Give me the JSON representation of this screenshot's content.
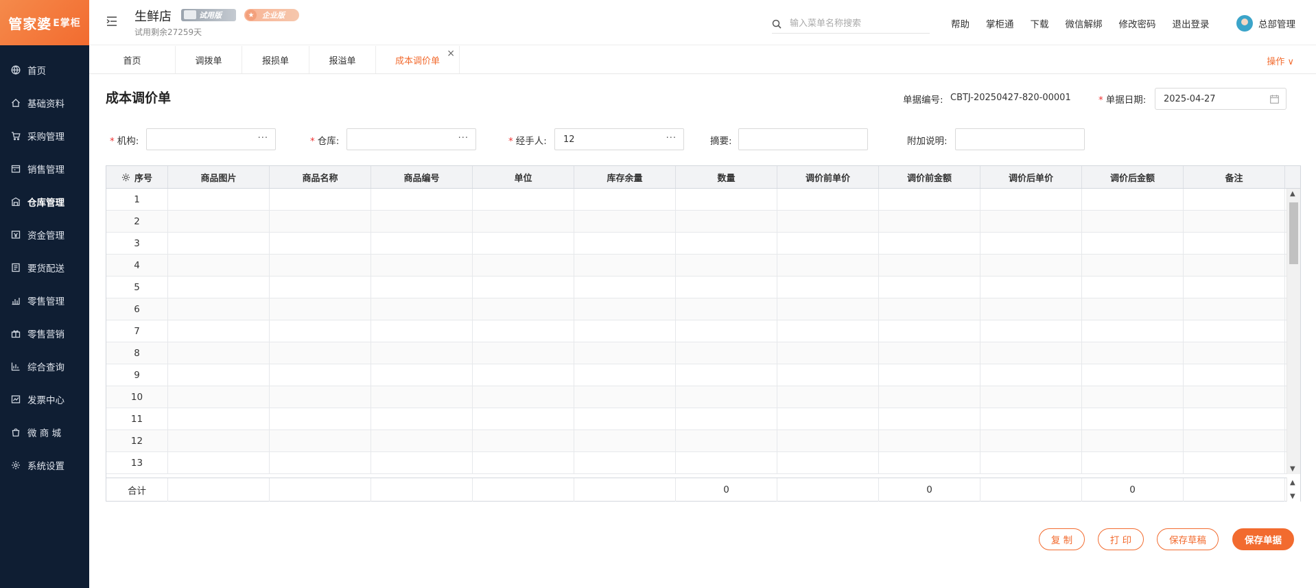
{
  "app": {
    "logo_main": "管家婆",
    "logo_sub": "E掌柜",
    "store_name": "生鲜店",
    "trial_badge": "试用版",
    "enterprise_badge": "企业版",
    "trial_remaining": "试用剩余27259天"
  },
  "sidebar": {
    "items": [
      {
        "label": "首页",
        "icon": "globe-icon"
      },
      {
        "label": "基础资料",
        "icon": "home-icon"
      },
      {
        "label": "采购管理",
        "icon": "cart-icon"
      },
      {
        "label": "销售管理",
        "icon": "sales-icon"
      },
      {
        "label": "仓库管理",
        "icon": "warehouse-icon"
      },
      {
        "label": "资金管理",
        "icon": "wallet-icon"
      },
      {
        "label": "要货配送",
        "icon": "delivery-icon"
      },
      {
        "label": "零售管理",
        "icon": "retail-icon"
      },
      {
        "label": "零售营销",
        "icon": "gift-icon"
      },
      {
        "label": "综合查询",
        "icon": "chart-icon"
      },
      {
        "label": "发票中心",
        "icon": "invoice-icon"
      },
      {
        "label": "微 商 城",
        "icon": "bag-icon"
      },
      {
        "label": "系统设置",
        "icon": "gear-icon"
      }
    ],
    "active_index": 4
  },
  "header": {
    "search_placeholder": "输入菜单名称搜索",
    "links": [
      "帮助",
      "掌柜通",
      "下载",
      "微信解绑",
      "修改密码",
      "退出登录"
    ],
    "user_name": "总部管理"
  },
  "tabs": {
    "items": [
      "首页",
      "调拨单",
      "报损单",
      "报溢单",
      "成本调价单"
    ],
    "active_index": 4,
    "close_symbol": "×",
    "operations_label": "操作 ∨"
  },
  "form": {
    "title": "成本调价单",
    "doc_no_label": "单据编号:",
    "doc_no_value": "CBTJ-20250427-820-00001",
    "doc_date_label": "单据日期:",
    "doc_date_value": "2025-04-27",
    "org_label": "机构:",
    "org_value": "",
    "warehouse_label": "仓库:",
    "warehouse_value": "",
    "handler_label": "经手人:",
    "handler_value": "12",
    "summary_label": "摘要:",
    "summary_value": "",
    "extra_label": "附加说明:",
    "extra_value": "",
    "picker_symbol": "···",
    "required_mark": "*"
  },
  "table": {
    "columns": [
      "序号",
      "商品图片",
      "商品名称",
      "商品编号",
      "单位",
      "库存余量",
      "数量",
      "调价前单价",
      "调价前金额",
      "调价后单价",
      "调价后金额",
      "备注"
    ],
    "rows": [
      "1",
      "2",
      "3",
      "4",
      "5",
      "6",
      "7",
      "8",
      "9",
      "10",
      "11",
      "12",
      "13"
    ],
    "footer": [
      "合计",
      "",
      "",
      "",
      "",
      "",
      "0",
      "",
      "0",
      "",
      "0",
      ""
    ]
  },
  "buttons": {
    "copy": "复 制",
    "print": "打 印",
    "save_draft": "保存草稿",
    "save": "保存单据"
  },
  "colors": {
    "accent": "#f26b2f",
    "sidebar_bg": "#0f1e33",
    "required": "#e33333"
  }
}
